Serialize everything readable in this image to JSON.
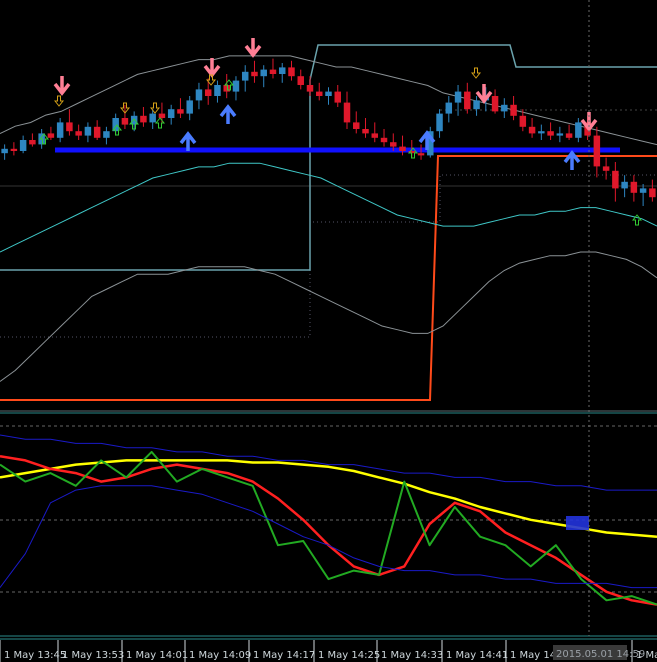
{
  "chart_data": [
    {
      "panel": "price",
      "type": "candlestick",
      "title": "",
      "grid": false,
      "colors": {
        "background": "#000000",
        "bull_candle": "#2e86c1",
        "bear_candle": "#e0182b",
        "bollinger_outer": "#8b9296",
        "bollinger_mid": "#3fc7c7",
        "support_line": "#1010ff",
        "stop_step_line": "#ff4a1a",
        "upper_step_line": "#6aa3ad",
        "sell_arrow": "#ff7f95",
        "buy_arrow": "#4a7cff",
        "small_up_arrow": "#33cc33",
        "small_down_arrow": "#d4a017"
      },
      "x_tick_labels": [
        "1 May 13:45",
        "1 May 13:53",
        "1 May 14:01",
        "1 May 14:09",
        "1 May 14:17",
        "1 May 14:25",
        "1 May 14:33",
        "1 May 14:41",
        "1 May 14",
        "1 Ma"
      ],
      "y_range": [
        0,
        100
      ],
      "candles": [
        {
          "o": 44,
          "h": 48,
          "l": 41,
          "c": 46
        },
        {
          "o": 46,
          "h": 49,
          "l": 43,
          "c": 45
        },
        {
          "o": 45,
          "h": 52,
          "l": 44,
          "c": 50
        },
        {
          "o": 50,
          "h": 53,
          "l": 47,
          "c": 48
        },
        {
          "o": 48,
          "h": 55,
          "l": 46,
          "c": 53
        },
        {
          "o": 53,
          "h": 56,
          "l": 50,
          "c": 51
        },
        {
          "o": 51,
          "h": 60,
          "l": 49,
          "c": 58
        },
        {
          "o": 58,
          "h": 64,
          "l": 52,
          "c": 54
        },
        {
          "o": 54,
          "h": 57,
          "l": 50,
          "c": 52
        },
        {
          "o": 52,
          "h": 58,
          "l": 49,
          "c": 56
        },
        {
          "o": 56,
          "h": 59,
          "l": 50,
          "c": 51
        },
        {
          "o": 51,
          "h": 56,
          "l": 48,
          "c": 54
        },
        {
          "o": 54,
          "h": 62,
          "l": 52,
          "c": 60
        },
        {
          "o": 60,
          "h": 66,
          "l": 55,
          "c": 57
        },
        {
          "o": 57,
          "h": 63,
          "l": 54,
          "c": 61
        },
        {
          "o": 61,
          "h": 65,
          "l": 56,
          "c": 58
        },
        {
          "o": 58,
          "h": 64,
          "l": 55,
          "c": 62
        },
        {
          "o": 62,
          "h": 67,
          "l": 58,
          "c": 60
        },
        {
          "o": 60,
          "h": 66,
          "l": 57,
          "c": 64
        },
        {
          "o": 64,
          "h": 69,
          "l": 60,
          "c": 62
        },
        {
          "o": 62,
          "h": 70,
          "l": 59,
          "c": 68
        },
        {
          "o": 68,
          "h": 76,
          "l": 64,
          "c": 73
        },
        {
          "o": 73,
          "h": 78,
          "l": 66,
          "c": 70
        },
        {
          "o": 70,
          "h": 77,
          "l": 67,
          "c": 75
        },
        {
          "o": 75,
          "h": 80,
          "l": 69,
          "c": 72
        },
        {
          "o": 72,
          "h": 79,
          "l": 68,
          "c": 77
        },
        {
          "o": 77,
          "h": 84,
          "l": 72,
          "c": 81
        },
        {
          "o": 81,
          "h": 86,
          "l": 76,
          "c": 79
        },
        {
          "o": 79,
          "h": 84,
          "l": 74,
          "c": 82
        },
        {
          "o": 82,
          "h": 87,
          "l": 78,
          "c": 80
        },
        {
          "o": 80,
          "h": 85,
          "l": 76,
          "c": 83
        },
        {
          "o": 83,
          "h": 86,
          "l": 77,
          "c": 79
        },
        {
          "o": 79,
          "h": 82,
          "l": 73,
          "c": 75
        },
        {
          "o": 75,
          "h": 79,
          "l": 70,
          "c": 72
        },
        {
          "o": 72,
          "h": 76,
          "l": 68,
          "c": 70
        },
        {
          "o": 70,
          "h": 74,
          "l": 66,
          "c": 72
        },
        {
          "o": 72,
          "h": 75,
          "l": 65,
          "c": 67
        },
        {
          "o": 67,
          "h": 72,
          "l": 55,
          "c": 58
        },
        {
          "o": 58,
          "h": 63,
          "l": 53,
          "c": 55
        },
        {
          "o": 55,
          "h": 60,
          "l": 51,
          "c": 53
        },
        {
          "o": 53,
          "h": 58,
          "l": 49,
          "c": 51
        },
        {
          "o": 51,
          "h": 55,
          "l": 47,
          "c": 49
        },
        {
          "o": 49,
          "h": 53,
          "l": 45,
          "c": 47
        },
        {
          "o": 47,
          "h": 52,
          "l": 43,
          "c": 45
        },
        {
          "o": 45,
          "h": 50,
          "l": 42,
          "c": 44
        },
        {
          "o": 44,
          "h": 48,
          "l": 41,
          "c": 43
        },
        {
          "o": 43,
          "h": 56,
          "l": 42,
          "c": 54
        },
        {
          "o": 54,
          "h": 64,
          "l": 51,
          "c": 62
        },
        {
          "o": 62,
          "h": 70,
          "l": 58,
          "c": 67
        },
        {
          "o": 67,
          "h": 75,
          "l": 61,
          "c": 72
        },
        {
          "o": 72,
          "h": 76,
          "l": 62,
          "c": 64
        },
        {
          "o": 64,
          "h": 70,
          "l": 61,
          "c": 68
        },
        {
          "o": 68,
          "h": 74,
          "l": 63,
          "c": 70
        },
        {
          "o": 70,
          "h": 73,
          "l": 62,
          "c": 63
        },
        {
          "o": 63,
          "h": 69,
          "l": 60,
          "c": 66
        },
        {
          "o": 66,
          "h": 70,
          "l": 59,
          "c": 61
        },
        {
          "o": 61,
          "h": 64,
          "l": 54,
          "c": 56
        },
        {
          "o": 56,
          "h": 60,
          "l": 51,
          "c": 53
        },
        {
          "o": 53,
          "h": 57,
          "l": 50,
          "c": 54
        },
        {
          "o": 54,
          "h": 58,
          "l": 50,
          "c": 52
        },
        {
          "o": 52,
          "h": 56,
          "l": 49,
          "c": 53
        },
        {
          "o": 53,
          "h": 57,
          "l": 50,
          "c": 51
        },
        {
          "o": 51,
          "h": 60,
          "l": 49,
          "c": 58
        },
        {
          "o": 58,
          "h": 61,
          "l": 50,
          "c": 52
        },
        {
          "o": 52,
          "h": 56,
          "l": 33,
          "c": 38
        },
        {
          "o": 38,
          "h": 42,
          "l": 32,
          "c": 36
        },
        {
          "o": 36,
          "h": 40,
          "l": 22,
          "c": 28
        },
        {
          "o": 28,
          "h": 34,
          "l": 24,
          "c": 31
        },
        {
          "o": 31,
          "h": 34,
          "l": 22,
          "c": 26
        },
        {
          "o": 26,
          "h": 30,
          "l": 20,
          "c": 28
        },
        {
          "o": 28,
          "h": 32,
          "l": 22,
          "c": 24
        }
      ],
      "bollinger": {
        "upper": [
          72,
          74,
          75,
          77,
          78,
          80,
          82,
          84,
          86,
          88,
          89,
          90,
          91,
          92,
          92,
          93,
          93,
          93,
          93,
          93,
          92,
          91,
          90,
          90,
          89,
          88,
          87,
          86,
          85,
          83,
          82,
          81,
          80,
          79,
          78,
          77,
          76,
          75,
          74,
          73,
          72,
          71,
          70,
          69
        ],
        "middle": [
          40,
          42,
          44,
          46,
          48,
          50,
          52,
          54,
          56,
          58,
          60,
          61,
          62,
          63,
          63,
          64,
          64,
          64,
          63,
          62,
          61,
          60,
          58,
          56,
          54,
          52,
          50,
          49,
          48,
          47,
          47,
          47,
          48,
          49,
          50,
          50,
          51,
          51,
          52,
          52,
          51,
          50,
          49,
          47
        ],
        "lower": [
          5,
          8,
          12,
          16,
          20,
          24,
          28,
          30,
          32,
          34,
          34,
          34,
          35,
          36,
          36,
          36,
          36,
          35,
          34,
          32,
          30,
          28,
          26,
          24,
          22,
          20,
          19,
          18,
          18,
          20,
          24,
          28,
          32,
          35,
          37,
          38,
          39,
          39,
          40,
          40,
          39,
          38,
          36,
          33
        ]
      },
      "support_level": 52,
      "upper_step": [
        95,
        88
      ],
      "stop_step": [
        5,
        48
      ]
    },
    {
      "panel": "oscillator",
      "type": "line",
      "title": "",
      "grid": false,
      "y_range": [
        0,
        100
      ],
      "series": [
        {
          "color": "#ffff00",
          "values": [
            72,
            74,
            76,
            78,
            79,
            80,
            80,
            80,
            80,
            80,
            79,
            79,
            78,
            77,
            75,
            72,
            69,
            65,
            62,
            58,
            55,
            52,
            50,
            48,
            46,
            45,
            44
          ]
        },
        {
          "color": "#ff2020",
          "values": [
            82,
            80,
            76,
            74,
            70,
            72,
            76,
            78,
            76,
            74,
            70,
            62,
            52,
            40,
            30,
            26,
            30,
            50,
            60,
            56,
            46,
            40,
            34,
            26,
            18,
            14,
            12
          ]
        },
        {
          "color": "#22aa22",
          "values": [
            78,
            70,
            74,
            68,
            80,
            72,
            84,
            70,
            76,
            72,
            68,
            40,
            42,
            24,
            28,
            26,
            70,
            40,
            58,
            44,
            40,
            30,
            40,
            24,
            14,
            16,
            12
          ]
        },
        {
          "color": "#1a1ac8",
          "values": [
            92,
            90,
            90,
            88,
            88,
            86,
            86,
            84,
            84,
            82,
            82,
            80,
            80,
            78,
            78,
            76,
            74,
            74,
            72,
            72,
            70,
            70,
            68,
            68,
            66,
            66,
            66
          ]
        },
        {
          "color": "#1a1ac8",
          "values": [
            20,
            36,
            60,
            66,
            68,
            68,
            68,
            66,
            64,
            60,
            56,
            50,
            44,
            40,
            34,
            30,
            28,
            28,
            26,
            26,
            24,
            24,
            22,
            22,
            22,
            20,
            20
          ]
        }
      ],
      "levels": [
        80,
        50,
        20
      ]
    }
  ],
  "cursor_time_label": "2015.05.01 14:59"
}
